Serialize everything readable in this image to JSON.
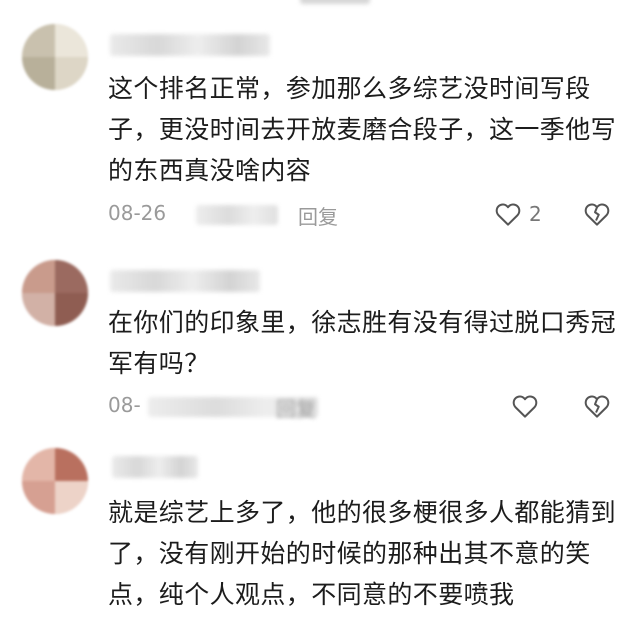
{
  "comments": [
    {
      "text": "这个排名正常，参加那么多综艺没时间写段子，更没时间去开放麦磨合段子，这一季他写的东西真没啥内容",
      "date": "08-26",
      "reply_label": "回复",
      "like_count": "2"
    },
    {
      "text": "在你们的印象里，徐志胜有没有得过脱口秀冠军有吗？",
      "date": "08-",
      "reply_label": "回复",
      "like_count": ""
    },
    {
      "text": "就是综艺上多了，他的很多梗很多人都能猜到了，没有刚开始的时候的那种出其不意的笑点，纯个人观点，不同意的不要喷我"
    }
  ],
  "icons": {
    "like": "heart-outline-icon",
    "dislike": "broken-heart-icon"
  },
  "colors": {
    "text": "#1c1c1c",
    "meta": "#9a9a9a",
    "icon": "#555555"
  }
}
